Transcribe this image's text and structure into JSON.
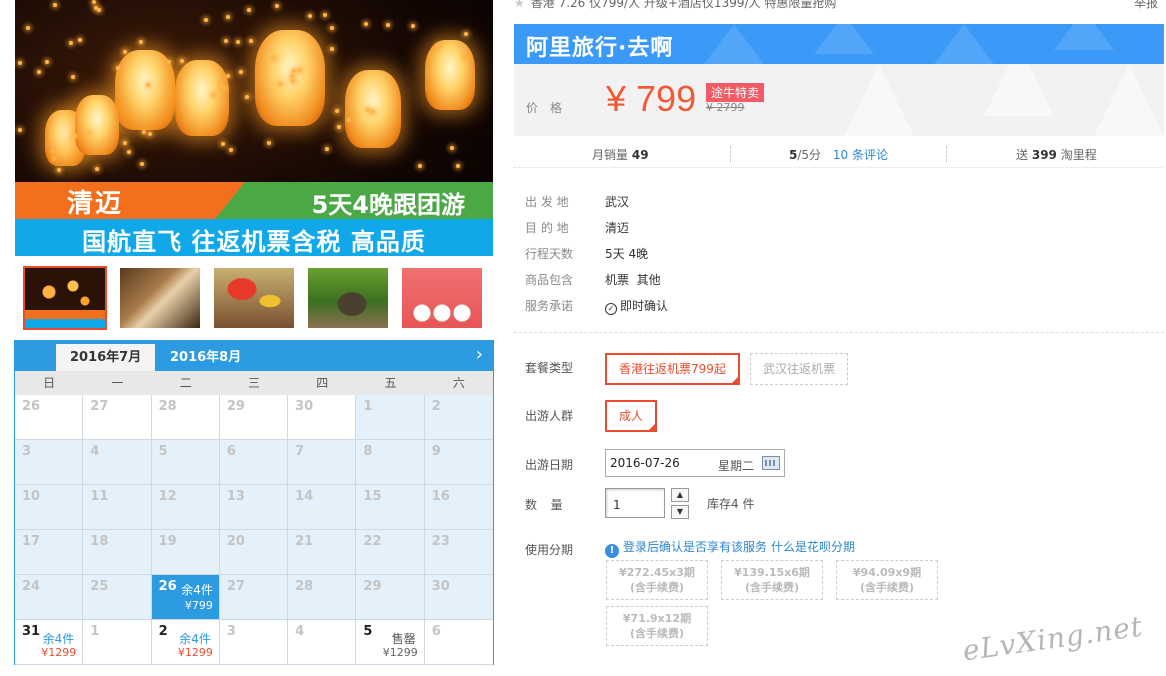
{
  "hero": {
    "title_left": "清迈",
    "title_right": "5天4晚跟团游",
    "subtitle": "国航直飞 往返机票含税 高品质"
  },
  "thumbnails": [
    {
      "name": "lantern-festival",
      "active": true
    },
    {
      "name": "craft-workshop",
      "active": false
    },
    {
      "name": "festival-umbrellas",
      "active": false
    },
    {
      "name": "elephant-trekking",
      "active": false
    },
    {
      "name": "tour-poster",
      "active": false
    }
  ],
  "calendar": {
    "tabs": [
      "2016年7月",
      "2016年8月"
    ],
    "weekdays": [
      "日",
      "一",
      "二",
      "三",
      "四",
      "五",
      "六"
    ],
    "rows": [
      [
        {
          "d": "26"
        },
        {
          "d": "27"
        },
        {
          "d": "28"
        },
        {
          "d": "29"
        },
        {
          "d": "30"
        },
        {
          "d": "1",
          "blue": true
        },
        {
          "d": "2",
          "blue": true
        }
      ],
      [
        {
          "d": "3",
          "blue": true
        },
        {
          "d": "4",
          "blue": true
        },
        {
          "d": "5",
          "blue": true
        },
        {
          "d": "6",
          "blue": true
        },
        {
          "d": "7",
          "blue": true
        },
        {
          "d": "8",
          "blue": true
        },
        {
          "d": "9",
          "blue": true
        }
      ],
      [
        {
          "d": "10",
          "blue": true
        },
        {
          "d": "11",
          "blue": true
        },
        {
          "d": "12",
          "blue": true
        },
        {
          "d": "13",
          "blue": true
        },
        {
          "d": "14",
          "blue": true
        },
        {
          "d": "15",
          "blue": true
        },
        {
          "d": "16",
          "blue": true
        }
      ],
      [
        {
          "d": "17",
          "blue": true
        },
        {
          "d": "18",
          "blue": true
        },
        {
          "d": "19",
          "blue": true
        },
        {
          "d": "20",
          "blue": true
        },
        {
          "d": "21",
          "blue": true
        },
        {
          "d": "22",
          "blue": true
        },
        {
          "d": "23",
          "blue": true
        }
      ],
      [
        {
          "d": "24",
          "blue": true
        },
        {
          "d": "25",
          "blue": true
        },
        {
          "d": "26",
          "sel": true,
          "stock": "余4件",
          "price": "¥799"
        },
        {
          "d": "27",
          "blue": true
        },
        {
          "d": "28",
          "blue": true
        },
        {
          "d": "29",
          "blue": true
        },
        {
          "d": "30",
          "blue": true
        }
      ],
      [
        {
          "d": "31",
          "avail": true,
          "stock": "余4件",
          "price": "¥1299"
        },
        {
          "d": "1"
        },
        {
          "d": "2",
          "avail": true,
          "stock": "余4件",
          "price": "¥1299"
        },
        {
          "d": "3"
        },
        {
          "d": "4"
        },
        {
          "d": "5",
          "avail": true,
          "sold": true,
          "stock": "售罄",
          "price": "¥1299"
        },
        {
          "d": "6"
        }
      ]
    ]
  },
  "top": {
    "headline": "香港 7.26 仅799/人 升级+酒店仅1399/人 特惠限量抢购",
    "report": "举报"
  },
  "banner": {
    "title": "阿里旅行·去啊"
  },
  "price": {
    "label": "价格",
    "current": "¥ 799",
    "badge": "途牛特卖",
    "original": "¥ 2799"
  },
  "stats": {
    "monthly_sales_label": "月销量",
    "monthly_sales": "49",
    "rating": "5",
    "rating_suffix": "/5分",
    "reviews": "10 条评论",
    "points_prefix": "送",
    "points": "399",
    "points_suffix": "淘里程"
  },
  "info": [
    {
      "k": "出 发 地",
      "v": "武汉"
    },
    {
      "k": "目 的 地",
      "v": "清迈"
    },
    {
      "k": "行程天数",
      "v": "5天 4晚"
    },
    {
      "k": "商品包含",
      "v": "机票  其他"
    },
    {
      "k": "服务承诺",
      "v": "即时确认"
    }
  ],
  "options": {
    "package_label": "套餐类型",
    "package_selected": "香港往返机票799起",
    "package_other": "武汉往返机票",
    "people_label": "出游人群",
    "people_selected": "成人",
    "date_label": "出游日期",
    "date_value": "2016-07-26",
    "weekday": "星期二",
    "qty_label": "数  量",
    "qty_value": "1",
    "stock": "库存4 件",
    "installment_label": "使用分期",
    "installment_note": "登录后确认是否享有该服务",
    "installment_link": "什么是花呗分期",
    "installments": [
      {
        "amount": "¥272.45x3期",
        "fee": "(含手续费)"
      },
      {
        "amount": "¥139.15x6期",
        "fee": "(含手续费)"
      },
      {
        "amount": "¥94.09x9期",
        "fee": "(含手续费)"
      },
      {
        "amount": "¥71.9x12期",
        "fee": "(含手续费)"
      }
    ]
  },
  "watermark": "eLvXing.net"
}
